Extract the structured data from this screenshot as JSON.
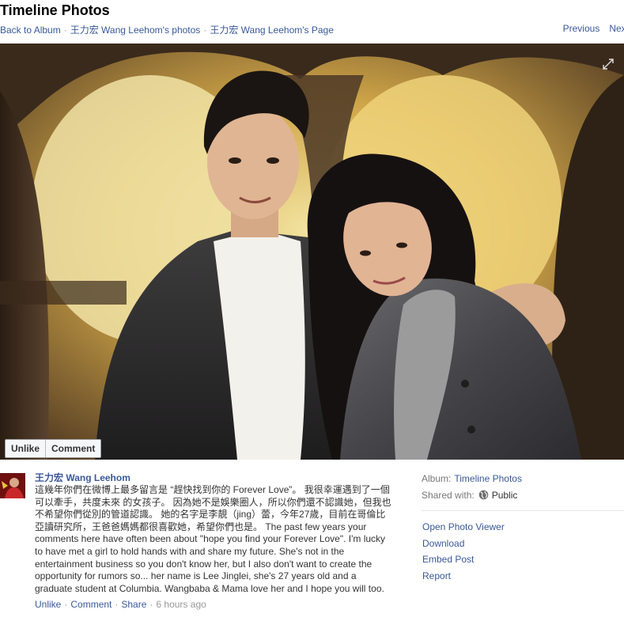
{
  "header": {
    "title": "Timeline Photos",
    "breadcrumb": {
      "back": "Back to Album",
      "photos": "王力宏 Wang Leehom's photos",
      "page": "王力宏 Wang Leehom's Page"
    },
    "previous": "Previous",
    "next": "Next"
  },
  "photo": {
    "fullscreen_icon": "expand-icon",
    "actions": {
      "unlike": "Unlike",
      "comment": "Comment"
    }
  },
  "post": {
    "author": "王力宏 Wang Leehom",
    "caption": "這幾年你們在微博上最多留言是 “趕快找到你的 Forever Love”。 我很幸運遇到了一個可以牽手，共度未來 的女孩子。 因為她不是娛樂圈人，所以你們還不認識她，但我也不希望你們從別的管道認識。 她的名字是李靚（jing）蕾，今年27歲，目前在哥倫比亞讀研究所，王爸爸媽媽都很喜歡她，希望你們也是。 The past few years your comments here have often been about \"hope you find your Forever Love\". I'm lucky to have met a girl to hold hands with and share my future. She's not in the entertainment business so you don't know her, but I also don't want to create the opportunity for rumors so... her name is Lee Jinglei, she's 27 years old and a graduate student at Columbia. Wangbaba & Mama love her and I hope you will too.",
    "meta": {
      "unlike": "Unlike",
      "comment": "Comment",
      "share": "Share",
      "time": "6 hours ago"
    }
  },
  "sidebar": {
    "album_label": "Album:",
    "album_value": "Timeline Photos",
    "shared_label": "Shared with:",
    "shared_value": "Public",
    "links": [
      "Open Photo Viewer",
      "Download",
      "Embed Post",
      "Report"
    ]
  },
  "colors": {
    "link": "#3b5998",
    "muted": "#999999",
    "text": "#333333"
  }
}
